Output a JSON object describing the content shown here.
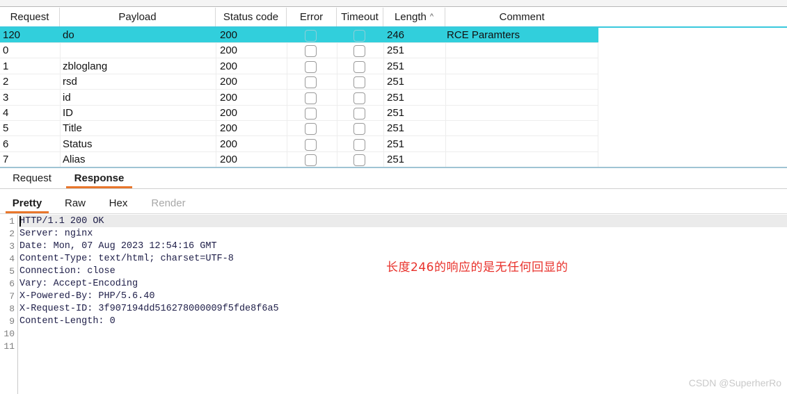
{
  "colors": {
    "selected_row": "#31cfdc",
    "tab_accent": "#e8762b",
    "annotation": "#e8302a",
    "header_rule": "#39c9dd",
    "watermark": "#c9c9c9"
  },
  "results_table": {
    "columns": [
      {
        "key": "request",
        "label": "Request",
        "sorted": false
      },
      {
        "key": "payload",
        "label": "Payload",
        "sorted": false
      },
      {
        "key": "status_code",
        "label": "Status code",
        "sorted": false
      },
      {
        "key": "error",
        "label": "Error",
        "sorted": false
      },
      {
        "key": "timeout",
        "label": "Timeout",
        "sorted": false
      },
      {
        "key": "length",
        "label": "Length",
        "sorted": true,
        "sort_caret": "^"
      },
      {
        "key": "comment",
        "label": "Comment",
        "sorted": false
      }
    ],
    "rows": [
      {
        "request": "120",
        "payload": "do",
        "status_code": "200",
        "error": false,
        "timeout": false,
        "length": "246",
        "comment": "RCE Paramters",
        "selected": true
      },
      {
        "request": "0",
        "payload": "",
        "status_code": "200",
        "error": false,
        "timeout": false,
        "length": "251",
        "comment": "",
        "selected": false
      },
      {
        "request": "1",
        "payload": "zbloglang",
        "status_code": "200",
        "error": false,
        "timeout": false,
        "length": "251",
        "comment": "",
        "selected": false
      },
      {
        "request": "2",
        "payload": "rsd",
        "status_code": "200",
        "error": false,
        "timeout": false,
        "length": "251",
        "comment": "",
        "selected": false
      },
      {
        "request": "3",
        "payload": "id",
        "status_code": "200",
        "error": false,
        "timeout": false,
        "length": "251",
        "comment": "",
        "selected": false
      },
      {
        "request": "4",
        "payload": "ID",
        "status_code": "200",
        "error": false,
        "timeout": false,
        "length": "251",
        "comment": "",
        "selected": false
      },
      {
        "request": "5",
        "payload": "Title",
        "status_code": "200",
        "error": false,
        "timeout": false,
        "length": "251",
        "comment": "",
        "selected": false
      },
      {
        "request": "6",
        "payload": "Status",
        "status_code": "200",
        "error": false,
        "timeout": false,
        "length": "251",
        "comment": "",
        "selected": false
      },
      {
        "request": "7",
        "payload": "Alias",
        "status_code": "200",
        "error": false,
        "timeout": false,
        "length": "251",
        "comment": "",
        "selected": false
      }
    ]
  },
  "message_tabs": [
    {
      "label": "Request",
      "active": false
    },
    {
      "label": "Response",
      "active": true
    }
  ],
  "view_tabs": [
    {
      "label": "Pretty",
      "active": true,
      "disabled": false
    },
    {
      "label": "Raw",
      "active": false,
      "disabled": false
    },
    {
      "label": "Hex",
      "active": false,
      "disabled": false
    },
    {
      "label": "Render",
      "active": false,
      "disabled": true
    }
  ],
  "editor": {
    "lines": [
      {
        "no": "1",
        "text": "HTTP/1.1 200 OK"
      },
      {
        "no": "2",
        "text": "Server: nginx"
      },
      {
        "no": "3",
        "text": "Date: Mon, 07 Aug 2023 12:54:16 GMT"
      },
      {
        "no": "4",
        "text": "Content-Type: text/html; charset=UTF-8"
      },
      {
        "no": "5",
        "text": "Connection: close"
      },
      {
        "no": "6",
        "text": "Vary: Accept-Encoding"
      },
      {
        "no": "7",
        "text": "X-Powered-By: PHP/5.6.40"
      },
      {
        "no": "8",
        "text": "X-Request-ID: 3f907194dd516278000009f5fde8f6a5"
      },
      {
        "no": "9",
        "text": "Content-Length: 0"
      },
      {
        "no": "10",
        "text": ""
      },
      {
        "no": "11",
        "text": ""
      }
    ]
  },
  "annotation": {
    "text": "长度246的响应的是无任何回显的"
  },
  "watermark": {
    "text": "CSDN @SuperherRo"
  }
}
